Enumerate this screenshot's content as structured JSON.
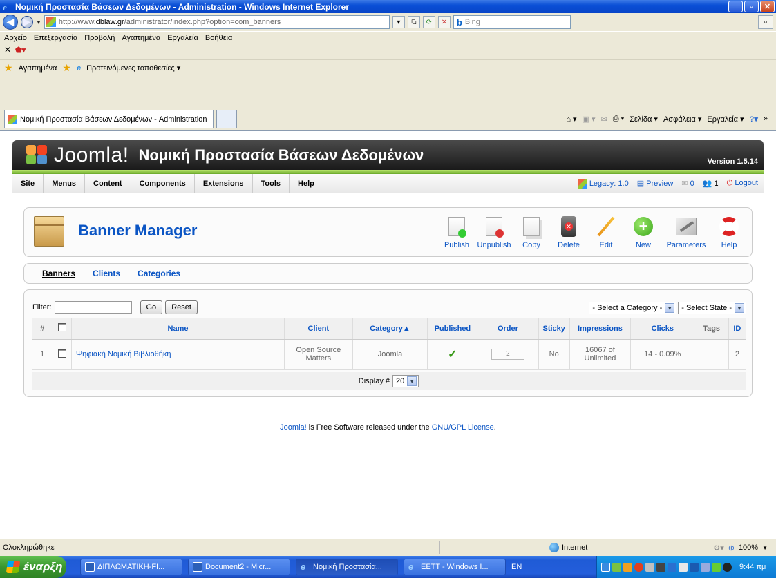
{
  "window": {
    "title": "Νομική Προστασία Βάσεων Δεδομένων - Administration - Windows Internet Explorer",
    "controls": [
      "_",
      "▫",
      "✕"
    ]
  },
  "addressbar": {
    "url_prefix": "http://www.",
    "url_domain": "dblaw.gr",
    "url_rest": "/administrator/index.php?option=com_banners",
    "search_placeholder": "Bing"
  },
  "menubar": [
    "Αρχείο",
    "Επεξεργασία",
    "Προβολή",
    "Αγαπημένα",
    "Εργαλεία",
    "Βοήθεια"
  ],
  "favbar": {
    "favorites": "Αγαπημένα",
    "suggested": "Προτεινόμενες τοποθεσίες ▾"
  },
  "tab": {
    "title": "Νομική Προστασία Βάσεων Δεδομένων - Administration"
  },
  "commandbar": {
    "page": "Σελίδα ▾",
    "safety": "Ασφάλεια ▾",
    "tools": "Εργαλεία ▾"
  },
  "joomla": {
    "brand": "Joomla!",
    "site_name": "Νομική Προστασία Βάσεων Δεδομένων",
    "version": "Version 1.5.14",
    "menu": [
      "Site",
      "Menus",
      "Content",
      "Components",
      "Extensions",
      "Tools",
      "Help"
    ],
    "legacy": "Legacy: 1.0",
    "preview": "Preview",
    "messages": "0",
    "users": "1",
    "logout": "Logout"
  },
  "manager": {
    "title": "Banner Manager",
    "toolbar": [
      "Publish",
      "Unpublish",
      "Copy",
      "Delete",
      "Edit",
      "New",
      "Parameters",
      "Help"
    ]
  },
  "subnav": [
    "Banners",
    "Clients",
    "Categories"
  ],
  "list": {
    "filter_label": "Filter:",
    "filter_value": "",
    "go": "Go",
    "reset": "Reset",
    "select_category": "- Select a Category -",
    "select_state": "- Select State -",
    "columns": [
      "#",
      "Name",
      "Client",
      "Category▲",
      "Published",
      "Order",
      "Sticky",
      "Impressions",
      "Clicks",
      "Tags",
      "ID"
    ],
    "rows": [
      {
        "num": "1",
        "name": "Ψηφιακή Νομική Βιβλιοθήκη",
        "client": "Open Source Matters",
        "category": "Joomla",
        "published": "✓",
        "order": "2",
        "sticky": "No",
        "impressions": "16067 of Unlimited",
        "clicks": "14 - 0.09%",
        "tags": "",
        "id": "2"
      }
    ],
    "display_label": "Display #",
    "display_value": "20"
  },
  "footer": {
    "lead": "Joomla!",
    "middle": " is Free Software released under the ",
    "link": "GNU/GPL License",
    "end": "."
  },
  "statusbar": {
    "status": "Ολοκληρώθηκε",
    "zone": "Internet",
    "zoom": "100%"
  },
  "taskbar": {
    "start": "έναρξη",
    "tasks": [
      "ΔΙΠΛΩΜΑΤΙΚΗ-FI...",
      "Document2 - Micr...",
      "Νομική Προστασία...",
      "EETT - Windows I..."
    ],
    "lang": "EN",
    "clock": "9:44 πμ"
  },
  "colors": {
    "link": "#0b55c4",
    "header": "#2a2a2a",
    "accent_green": "#6aa82a"
  }
}
